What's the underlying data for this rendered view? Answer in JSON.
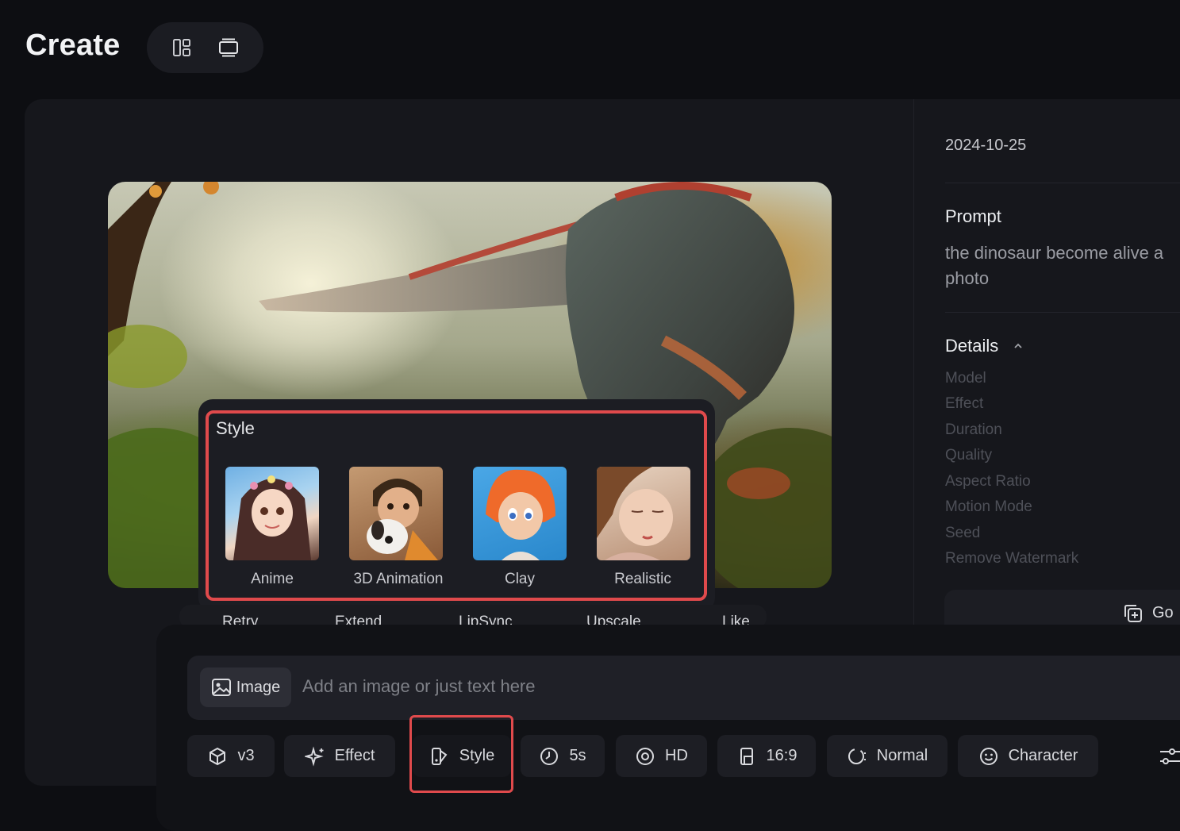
{
  "header": {
    "title": "Create",
    "view_icons": [
      "grid-layout-icon",
      "single-layout-icon"
    ]
  },
  "style_popover": {
    "title": "Style",
    "options": [
      {
        "label": "Anime"
      },
      {
        "label": "3D Animation"
      },
      {
        "label": "Clay"
      },
      {
        "label": "Realistic"
      }
    ]
  },
  "actions": [
    "Retry",
    "Extend",
    "LipSync",
    "Upscale",
    "Like"
  ],
  "sidebar": {
    "date": "2024-10-25",
    "prompt_heading": "Prompt",
    "prompt_line1": "the dinosaur become alive a",
    "prompt_line2": "photo",
    "details_heading": "Details",
    "details": [
      "Model",
      "Effect",
      "Duration",
      "Quality",
      "Aspect Ratio",
      "Motion Mode",
      "Seed",
      "Remove Watermark"
    ],
    "go_label": "Go"
  },
  "composer": {
    "image_button": "Image",
    "placeholder": "Add an image or just text here",
    "options": {
      "model": "v3",
      "effect": "Effect",
      "style": "Style",
      "duration": "5s",
      "quality": "HD",
      "aspect": "16:9",
      "motion": "Normal",
      "character": "Character"
    }
  },
  "colors": {
    "background": "#0d0e12",
    "panel": "#16171c",
    "highlight": "#e04a4c"
  }
}
